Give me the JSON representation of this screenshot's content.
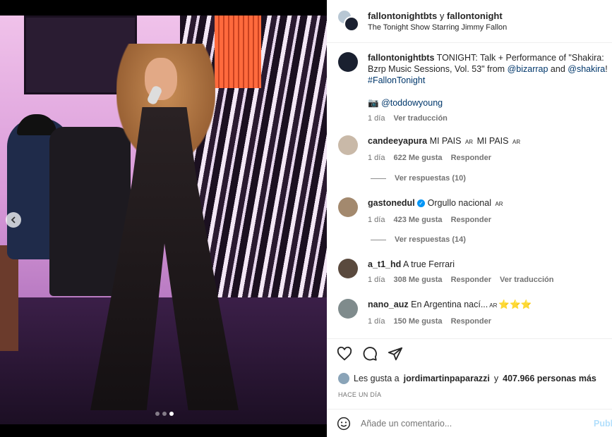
{
  "post": {
    "header": {
      "user1": "fallontonightbts",
      "joiner": "y",
      "user2": "fallontonight",
      "subtitle": "The Tonight Show Starring Jimmy Fallon"
    },
    "caption": {
      "username": "fallontonightbts",
      "text": "TONIGHT: Talk + Performance of \"Shakira: Bzrp Music Sessions, Vol. 53\" from",
      "mention1": "@bizarrap",
      "and": "and",
      "mention2": "@shakira",
      "bang": "!",
      "hashtag": "#FallonTonight",
      "camera_glyph": "📷",
      "credit": "@toddowyoung",
      "time": "1 día",
      "translate": "Ver traducción"
    },
    "comments": [
      {
        "username": "candeeyapura",
        "text": "MI PAIS",
        "flag1": "AR",
        "text2": "MI PAIS",
        "flag2": "AR",
        "time": "1 día",
        "likes": "622 Me gusta",
        "reply": "Responder",
        "replies": "Ver respuestas (10)"
      },
      {
        "username": "gastonedul",
        "text": "Orgullo nacional",
        "flag1": "AR",
        "time": "1 día",
        "likes": "423 Me gusta",
        "reply": "Responder",
        "replies": "Ver respuestas (14)"
      },
      {
        "username": "a_t1_hd",
        "text": "A true Ferrari",
        "time": "1 día",
        "likes": "308 Me gusta",
        "reply": "Responder",
        "translate": "Ver traducción"
      },
      {
        "username": "nano_auz",
        "text": "En Argentina nací...",
        "flag1": "AR",
        "stars": "⭐⭐⭐",
        "time": "1 día",
        "likes": "150 Me gusta",
        "reply": "Responder"
      }
    ],
    "likes_line": {
      "prefix": "Les gusta a",
      "user": "jordimartinpaparazzi",
      "middle": "y",
      "count": "407.966 personas más"
    },
    "timestamp": "HACE UN DÍA",
    "add_comment": {
      "placeholder": "Añade un comentario...",
      "post_label": "Publ"
    }
  },
  "icons": [
    "heart-icon",
    "comment-icon",
    "share-icon",
    "emoji-icon",
    "chevron-left-icon",
    "verified-icon"
  ],
  "colors": {
    "link": "#00376b",
    "verified": "#0095f6",
    "muted": "#737373"
  }
}
